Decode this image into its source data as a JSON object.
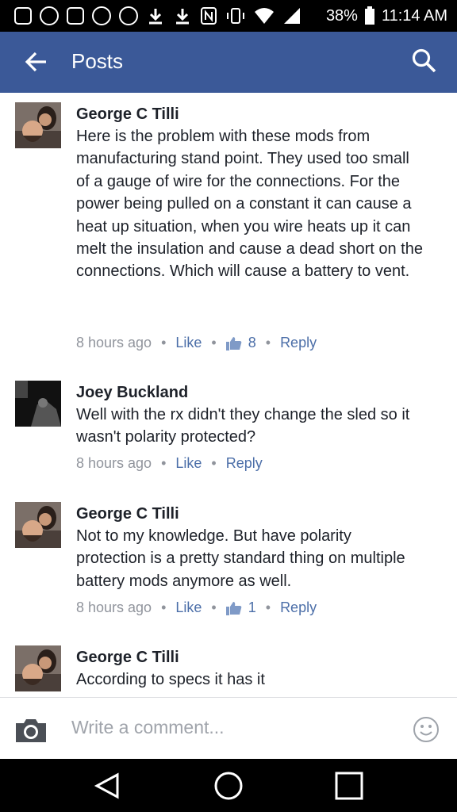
{
  "status_bar": {
    "battery_percent": "38%",
    "time": "11:14 AM",
    "left_icons": [
      "messenger-icon",
      "sync-icon",
      "gmail-icon",
      "wsop-icon",
      "poker-chip-icon",
      "download-icon",
      "download-icon",
      "nfc-icon",
      "vibrate-icon",
      "wifi-icon",
      "signal-icon"
    ]
  },
  "app_bar": {
    "title": "Posts",
    "bg_color": "#3b5998"
  },
  "comments": [
    {
      "name": "George C Tilli",
      "text": "Here is the problem with these mods from manufacturing stand point. They used too small of a gauge of wire for the connections. For the power being pulled on a constant it can cause a heat up situation, when you wire heats up it can melt the insulation and cause a dead short on the connections. Which will cause a battery to vent.",
      "time": "8 hours ago",
      "like_label": "Like",
      "like_count": "8",
      "reply_label": "Reply"
    },
    {
      "name": "Joey Buckland",
      "text": "Well with the rx didn't they change the sled so it wasn't polarity protected?",
      "time": "8 hours ago",
      "like_label": "Like",
      "reply_label": "Reply"
    },
    {
      "name": "George C Tilli",
      "text": "Not to my knowledge. But have polarity protection is a pretty standard thing on multiple battery mods anymore as well.",
      "time": "8 hours ago",
      "like_label": "Like",
      "like_count": "1",
      "reply_label": "Reply"
    },
    {
      "name": "George C Tilli",
      "text": "According to specs it has it"
    }
  ],
  "composer": {
    "placeholder": "Write a comment..."
  },
  "colors": {
    "link": "#4b6ea8",
    "meta": "#90949c",
    "text": "#1d2129"
  }
}
